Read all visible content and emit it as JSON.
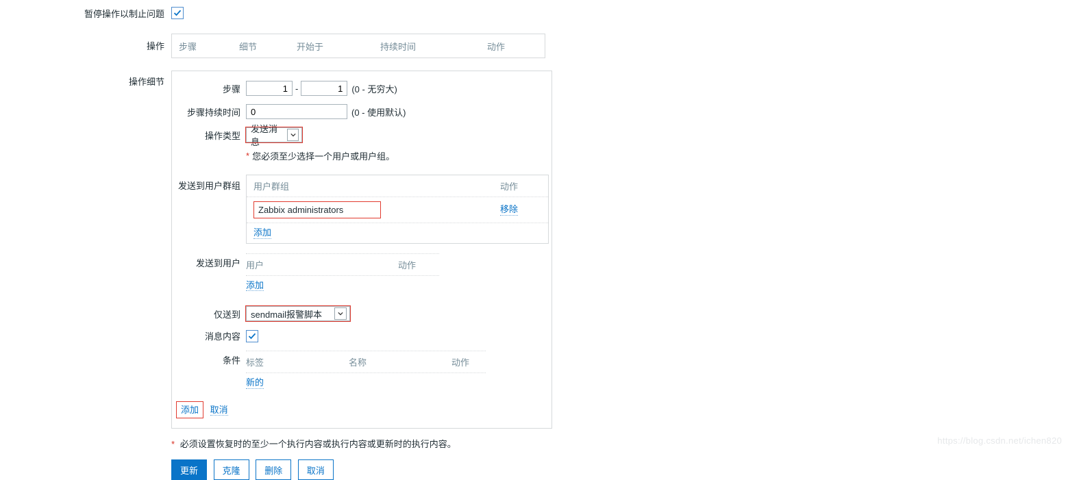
{
  "colors": {
    "accent": "#0a74c8",
    "highlight": "#e13b2f"
  },
  "pause": {
    "label": "暂停操作以制止问题",
    "checked": true
  },
  "operations": {
    "label": "操作",
    "columns": {
      "step": "步骤",
      "detail": "细节",
      "start": "开始于",
      "duration": "持续时间",
      "action": "动作"
    }
  },
  "detail": {
    "label": "操作细节",
    "step": {
      "label": "步骤",
      "from": "1",
      "to": "1",
      "hint": "(0 - 无穷大)"
    },
    "step_duration": {
      "label": "步骤持续时间",
      "value": "0",
      "hint": "(0 - 使用默认)"
    },
    "op_type": {
      "label": "操作类型",
      "value": "发送消息"
    },
    "required_msg": "您必须至少选择一个用户或用户组。",
    "send_to_group": {
      "label": "发送到用户群组",
      "columns": {
        "group": "用户群组",
        "action": "动作"
      },
      "row": {
        "name": "Zabbix administrators",
        "remove": "移除"
      },
      "add": "添加"
    },
    "send_to_user": {
      "label": "发送到用户",
      "columns": {
        "user": "用户",
        "action": "动作"
      },
      "add": "添加"
    },
    "only_send_to": {
      "label": "仅送到",
      "value": "sendmail报警脚本"
    },
    "msg_content": {
      "label": "消息内容",
      "checked": true
    },
    "conditions": {
      "label": "条件",
      "columns": {
        "label": "标签",
        "name": "名称",
        "action": "动作"
      },
      "new": "新的"
    },
    "bottom": {
      "add": "添加",
      "cancel": "取消"
    }
  },
  "footnote": "必须设置恢复时的至少一个执行内容或执行内容或更新时的执行内容。",
  "buttons": {
    "update": "更新",
    "clone": "克隆",
    "delete": "删除",
    "cancel": "取消"
  },
  "watermark": "https://blog.csdn.net/ichen820"
}
